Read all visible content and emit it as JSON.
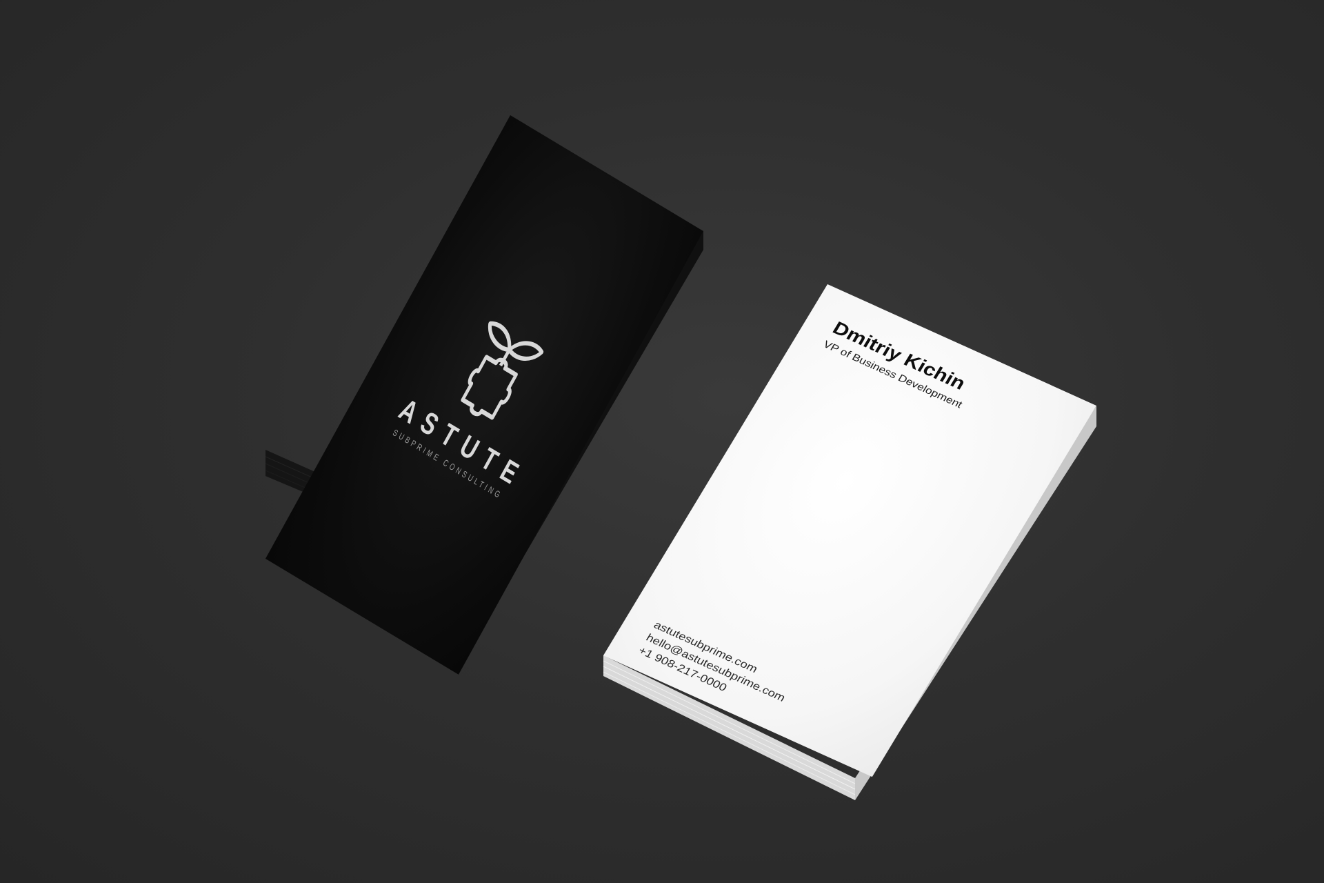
{
  "black_card": {
    "brand_name": "ASTUTE",
    "tagline": "SUBPRIME CONSULTING",
    "logo_icon": "puzzle-sprout-icon",
    "colors": {
      "card": "#0c0c0c",
      "logo": "#d8d8d8"
    }
  },
  "white_card": {
    "name": "Dmitriy Kichin",
    "role": "VP of Business Development",
    "website": "astutesubprime.com",
    "email": "hello@astutesubprime.com",
    "phone": "+1 908-217-0000",
    "colors": {
      "card": "#f6f6f6",
      "text": "#0d0d0d"
    }
  },
  "background_color": "#2f2f2f"
}
